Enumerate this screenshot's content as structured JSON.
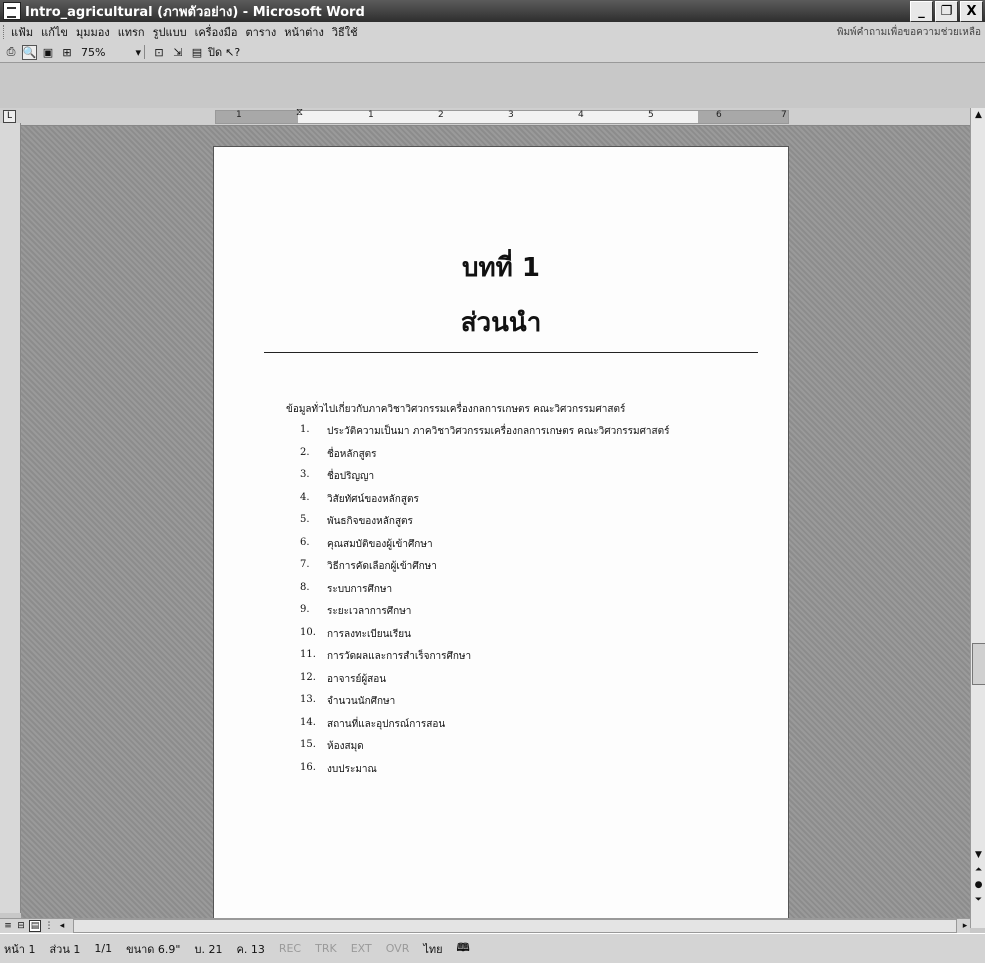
{
  "window": {
    "title": "Intro_agricultural (ภาพตัวอย่าง) - Microsoft Word",
    "minimize_label": "_",
    "restore_label": "❐",
    "close_label": "X"
  },
  "menubar": {
    "items": [
      "แฟ้ม",
      "แก้ไข",
      "มุมมอง",
      "แทรก",
      "รูปแบบ",
      "เครื่องมือ",
      "ตาราง",
      "หน้าต่าง",
      "วิธีใช้"
    ],
    "help_text": "พิมพ์คำถามเพื่อขอความช่วยเหลือ"
  },
  "toolbar": {
    "zoom_value": "75%",
    "close_label": "ปิด",
    "help_label": "?"
  },
  "ruler": {
    "tab_selector": "L",
    "numbers": [
      "1",
      "1",
      "2",
      "3",
      "4",
      "5",
      "6",
      "7"
    ]
  },
  "document": {
    "chapter_label": "บทที่ 1",
    "chapter_title": "ส่วนนำ",
    "intro_line": "ข้อมูลทั่วไปเกี่ยวกับภาควิชาวิศวกรรมเครื่องกลการเกษตร คณะวิศวกรรมศาสตร์",
    "items": [
      {
        "num": "1.",
        "text": "ประวัติความเป็นมา ภาควิชาวิศวกรรมเครื่องกลการเกษตร คณะวิศวกรรมศาสตร์"
      },
      {
        "num": "2.",
        "text": "ชื่อหลักสูตร"
      },
      {
        "num": "3.",
        "text": "ชื่อปริญญา"
      },
      {
        "num": "4.",
        "text": "วิสัยทัศน์ของหลักสูตร"
      },
      {
        "num": "5.",
        "text": "พันธกิจของหลักสูตร"
      },
      {
        "num": "6.",
        "text": "คุณสมบัติของผู้เข้าศึกษา"
      },
      {
        "num": "7.",
        "text": "วิธีการคัดเลือกผู้เข้าศึกษา"
      },
      {
        "num": "8.",
        "text": "ระบบการศึกษา"
      },
      {
        "num": "9.",
        "text": "ระยะเวลาการศึกษา"
      },
      {
        "num": "10.",
        "text": "การลงทะเบียนเรียน"
      },
      {
        "num": "11.",
        "text": "การวัดผลและการสำเร็จการศึกษา"
      },
      {
        "num": "12.",
        "text": "อาจารย์ผู้สอน"
      },
      {
        "num": "13.",
        "text": "จำนวนนักศึกษา"
      },
      {
        "num": "14.",
        "text": "สถานที่และอุปกรณ์การสอน"
      },
      {
        "num": "15.",
        "text": "ห้องสมุด"
      },
      {
        "num": "16.",
        "text": "งบประมาณ"
      }
    ]
  },
  "statusbar": {
    "page": "หน้า 1",
    "section": "ส่วน 1",
    "page_of": "1/1",
    "position": "ขนาด 6.9\"",
    "line": "บ. 21",
    "column": "ค. 13",
    "rec": "REC",
    "trk": "TRK",
    "ext": "EXT",
    "ovr": "OVR",
    "language": "ไทย"
  }
}
